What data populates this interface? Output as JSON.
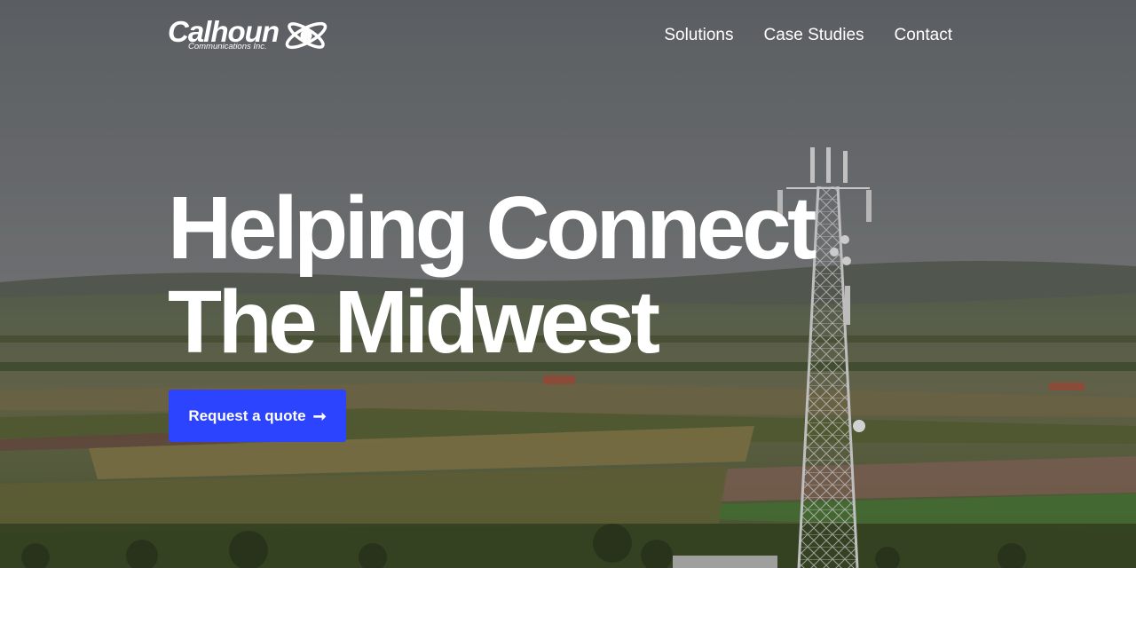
{
  "header": {
    "logo": {
      "name": "Calhoun",
      "tagline": "Communications Inc."
    },
    "nav": [
      {
        "label": "Solutions"
      },
      {
        "label": "Case Studies"
      },
      {
        "label": "Contact"
      }
    ]
  },
  "hero": {
    "headline_line1": "Helping Connect",
    "headline_line2": "The Midwest",
    "cta_label": "Request a quote",
    "cta_icon": "arrow-right-icon",
    "background": "aerial farmland landscape with cell tower"
  },
  "colors": {
    "cta": "#2d44ff",
    "text": "#ffffff",
    "page_bg": "#ffffff"
  }
}
